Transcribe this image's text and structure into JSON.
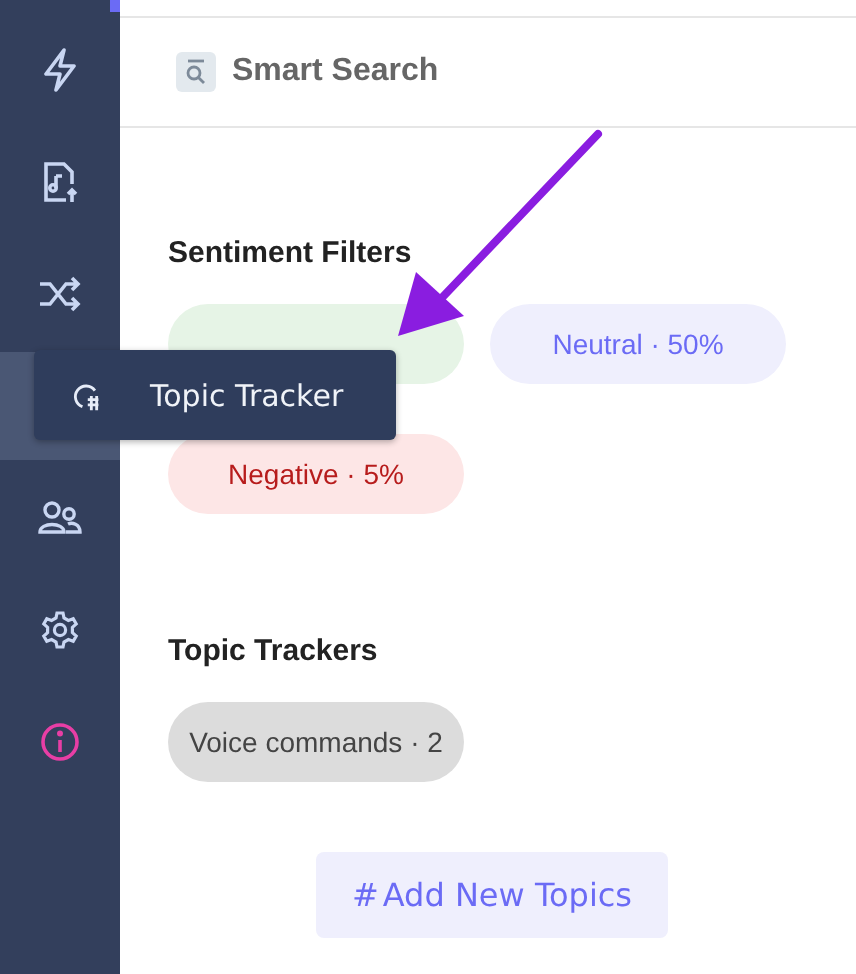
{
  "sidebar": {
    "items": [
      {
        "selected": false
      },
      {
        "selected": false
      },
      {
        "selected": false
      },
      {
        "selected": true
      },
      {
        "selected": false
      },
      {
        "selected": false
      },
      {
        "selected": false
      }
    ]
  },
  "tooltip": {
    "label": "Topic Tracker"
  },
  "header": {
    "title": "Smart Search"
  },
  "sentiment": {
    "title": "Sentiment Filters",
    "chips": [
      {
        "kind": "positive",
        "color": "#e6f4e6"
      },
      {
        "kind": "neutral",
        "label": "Neutral · 50%",
        "color": "#efeffd"
      },
      {
        "kind": "negative",
        "label": "Negative · 5%",
        "color": "#fde6e6"
      }
    ]
  },
  "topics": {
    "title": "Topic Trackers",
    "chips": [
      {
        "label": "Voice commands · 2"
      }
    ]
  },
  "add_button": {
    "label": "Add New Topics",
    "icon": "#"
  }
}
